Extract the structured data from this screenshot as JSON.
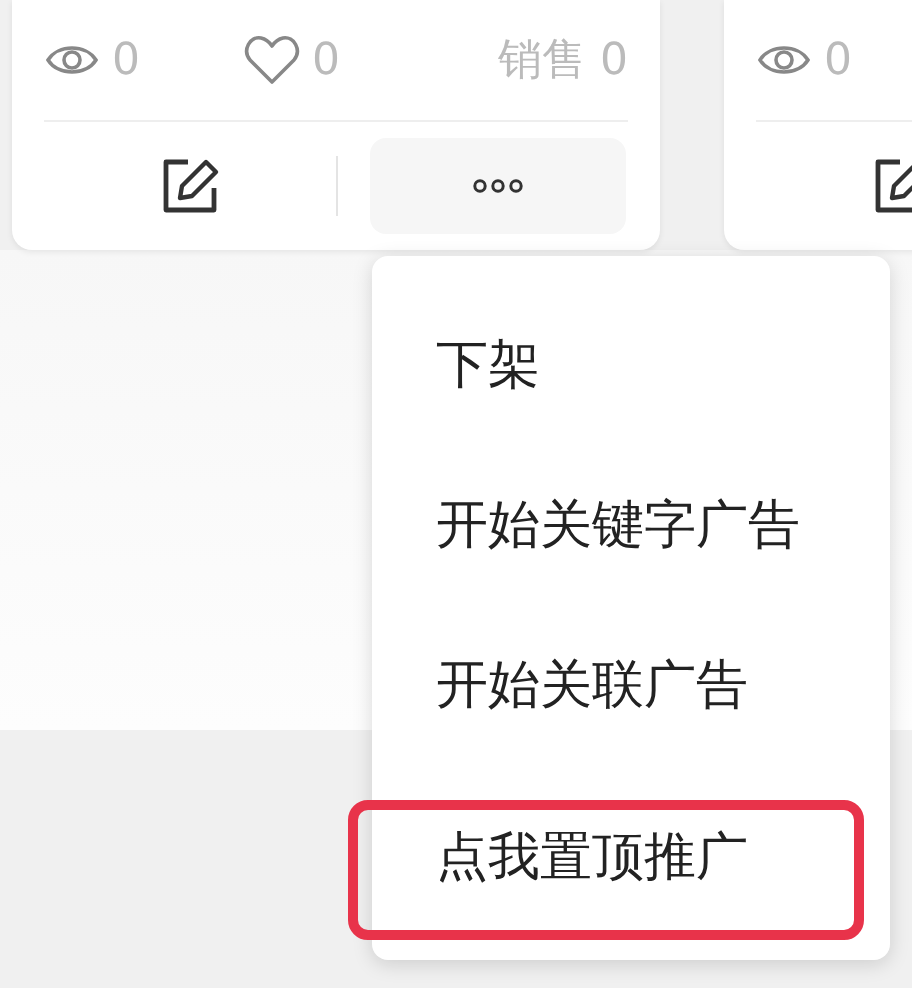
{
  "cards": [
    {
      "views": "0",
      "likes": "0",
      "sales_label": "销售",
      "sales": "0",
      "more_button": true
    },
    {
      "views": "0"
    }
  ],
  "menu": {
    "items": [
      {
        "label": "下架",
        "highlighted": false
      },
      {
        "label": "开始关键字广告",
        "highlighted": false
      },
      {
        "label": "开始关联广告",
        "highlighted": false
      },
      {
        "label": "点我置顶推广",
        "highlighted": true
      }
    ]
  }
}
